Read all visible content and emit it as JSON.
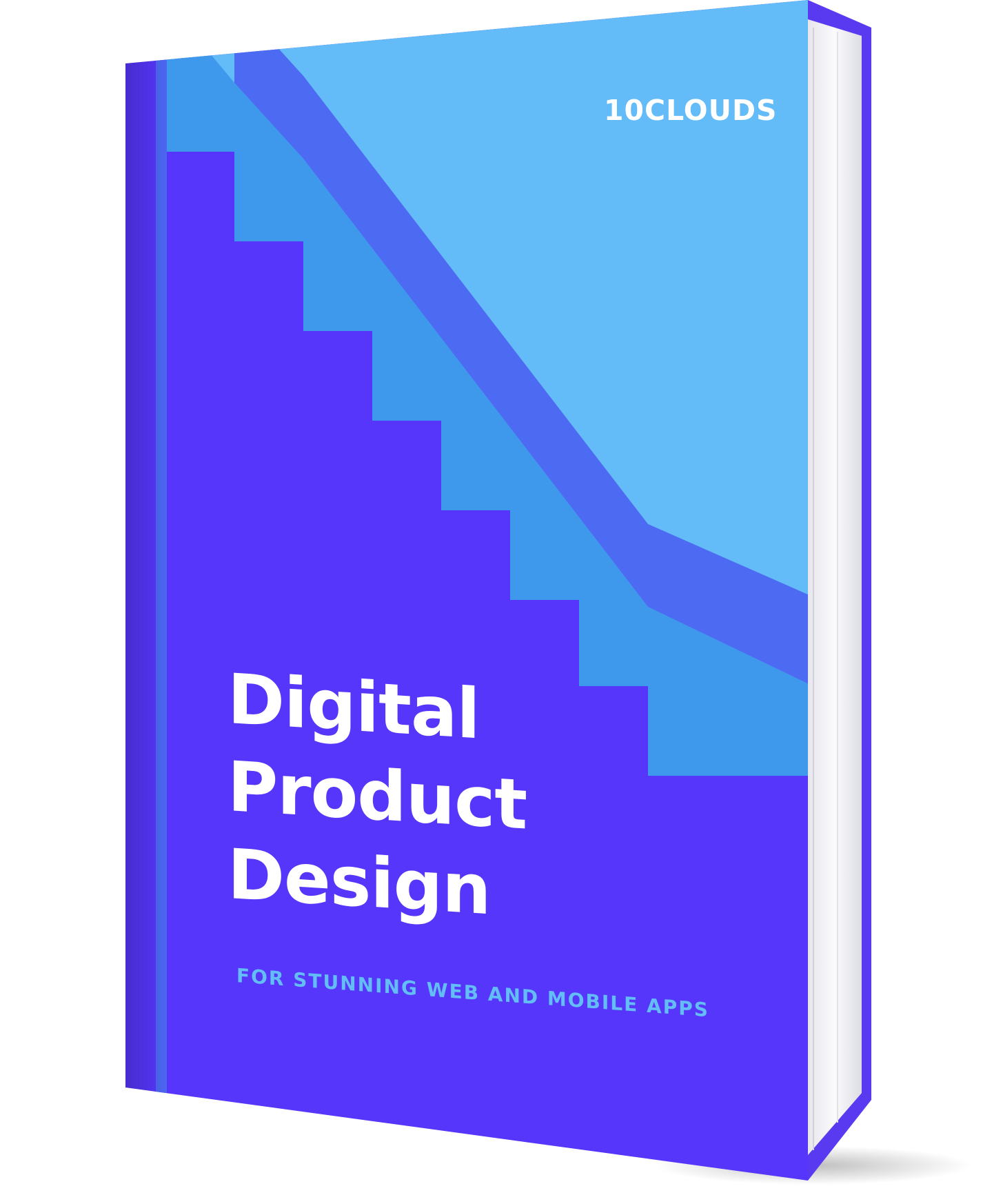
{
  "book": {
    "brand": "10CLOUDS",
    "title_lines": [
      "Digital",
      "Product",
      "Design"
    ],
    "subtitle": "FOR STUNNING WEB AND MOBILE APPS"
  },
  "colors": {
    "cover_main": "#5736fb",
    "stair_light": "#63bbf7",
    "stair_tread": "#3e98ec",
    "stair_riser": "#4c6af2",
    "spine_strip": "#4c66f2",
    "page_edge": "#f4f4f7",
    "back_cover": "#5a3af0",
    "title_text": "#ffffff",
    "subtitle_text": "#63bdf6"
  }
}
